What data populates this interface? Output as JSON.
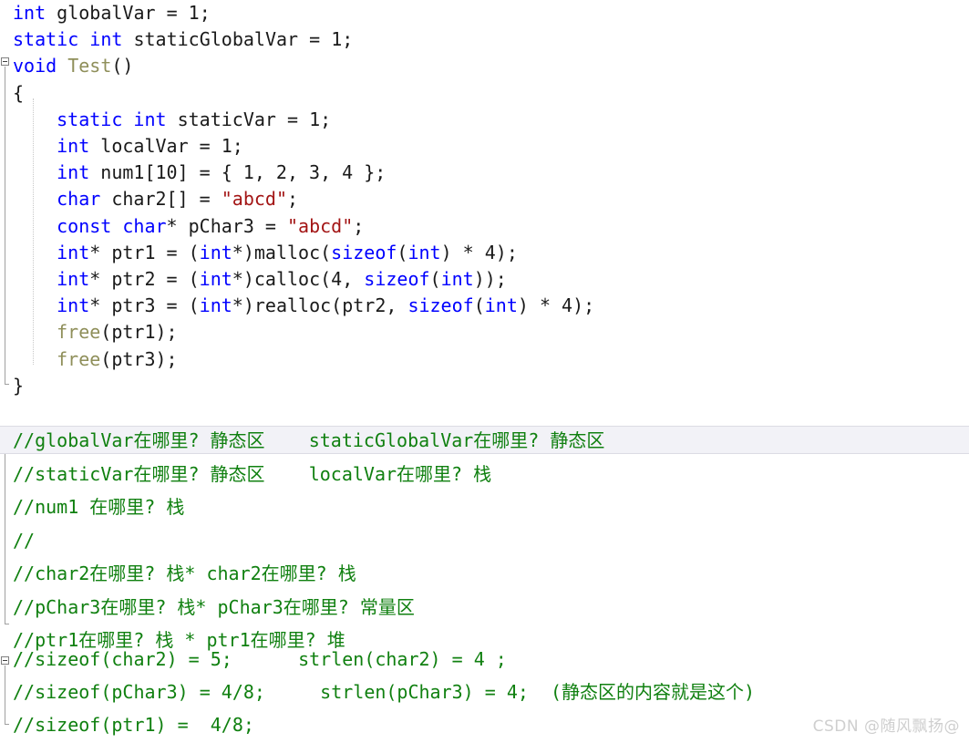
{
  "editor": {
    "name": "visual-studio-code-editor",
    "background": "#ffffff",
    "colors": {
      "keyword": "#0000ff",
      "function": "#8f8f5a",
      "string": "#a31515",
      "comment": "#108010",
      "plain": "#1a1a1a",
      "current_line_highlight": "#f2f2f7",
      "fold_marker": "#808080",
      "watermark": "#cfcfcf"
    }
  },
  "code": {
    "lines": [
      {
        "id": "line-1",
        "indent": 0,
        "tokens": [
          {
            "t": "int",
            "c": "kw"
          },
          {
            "t": " globalVar = 1;",
            "c": "plain"
          }
        ]
      },
      {
        "id": "line-2",
        "indent": 0,
        "tokens": [
          {
            "t": "static",
            "c": "kw"
          },
          {
            "t": " ",
            "c": "plain"
          },
          {
            "t": "int",
            "c": "kw"
          },
          {
            "t": " staticGlobalVar = 1;",
            "c": "plain"
          }
        ]
      },
      {
        "id": "line-3",
        "indent": 0,
        "tokens": [
          {
            "t": "void",
            "c": "kw"
          },
          {
            "t": " ",
            "c": "plain"
          },
          {
            "t": "Test",
            "c": "fn"
          },
          {
            "t": "()",
            "c": "plain"
          }
        ]
      },
      {
        "id": "line-4",
        "indent": 0,
        "tokens": [
          {
            "t": "{",
            "c": "plain"
          }
        ]
      },
      {
        "id": "line-5",
        "indent": 1,
        "tokens": [
          {
            "t": "static",
            "c": "kw"
          },
          {
            "t": " ",
            "c": "plain"
          },
          {
            "t": "int",
            "c": "kw"
          },
          {
            "t": " staticVar = 1;",
            "c": "plain"
          }
        ]
      },
      {
        "id": "line-6",
        "indent": 1,
        "tokens": [
          {
            "t": "int",
            "c": "kw"
          },
          {
            "t": " localVar = 1;",
            "c": "plain"
          }
        ]
      },
      {
        "id": "line-7",
        "indent": 1,
        "tokens": [
          {
            "t": "int",
            "c": "kw"
          },
          {
            "t": " num1[10] = { 1, 2, 3, 4 };",
            "c": "plain"
          }
        ]
      },
      {
        "id": "line-8",
        "indent": 1,
        "tokens": [
          {
            "t": "char",
            "c": "kw"
          },
          {
            "t": " char2[] = ",
            "c": "plain"
          },
          {
            "t": "\"abcd\"",
            "c": "str"
          },
          {
            "t": ";",
            "c": "plain"
          }
        ]
      },
      {
        "id": "line-9",
        "indent": 1,
        "tokens": [
          {
            "t": "const",
            "c": "kw"
          },
          {
            "t": " ",
            "c": "plain"
          },
          {
            "t": "char",
            "c": "kw"
          },
          {
            "t": "* pChar3 = ",
            "c": "plain"
          },
          {
            "t": "\"abcd\"",
            "c": "str"
          },
          {
            "t": ";",
            "c": "plain"
          }
        ]
      },
      {
        "id": "line-10",
        "indent": 1,
        "tokens": [
          {
            "t": "int",
            "c": "kw"
          },
          {
            "t": "* ptr1 = (",
            "c": "plain"
          },
          {
            "t": "int",
            "c": "kw"
          },
          {
            "t": "*)malloc(",
            "c": "plain"
          },
          {
            "t": "sizeof",
            "c": "kw"
          },
          {
            "t": "(",
            "c": "plain"
          },
          {
            "t": "int",
            "c": "kw"
          },
          {
            "t": ") * 4);",
            "c": "plain"
          }
        ]
      },
      {
        "id": "line-11",
        "indent": 1,
        "tokens": [
          {
            "t": "int",
            "c": "kw"
          },
          {
            "t": "* ptr2 = (",
            "c": "plain"
          },
          {
            "t": "int",
            "c": "kw"
          },
          {
            "t": "*)calloc(4, ",
            "c": "plain"
          },
          {
            "t": "sizeof",
            "c": "kw"
          },
          {
            "t": "(",
            "c": "plain"
          },
          {
            "t": "int",
            "c": "kw"
          },
          {
            "t": "));",
            "c": "plain"
          }
        ]
      },
      {
        "id": "line-12",
        "indent": 1,
        "tokens": [
          {
            "t": "int",
            "c": "kw"
          },
          {
            "t": "* ptr3 = (",
            "c": "plain"
          },
          {
            "t": "int",
            "c": "kw"
          },
          {
            "t": "*)realloc(ptr2, ",
            "c": "plain"
          },
          {
            "t": "sizeof",
            "c": "kw"
          },
          {
            "t": "(",
            "c": "plain"
          },
          {
            "t": "int",
            "c": "kw"
          },
          {
            "t": ") * 4);",
            "c": "plain"
          }
        ]
      },
      {
        "id": "line-13",
        "indent": 1,
        "tokens": [
          {
            "t": "free",
            "c": "fn"
          },
          {
            "t": "(ptr1);",
            "c": "plain"
          }
        ]
      },
      {
        "id": "line-14",
        "indent": 1,
        "tokens": [
          {
            "t": "free",
            "c": "fn"
          },
          {
            "t": "(ptr3);",
            "c": "plain"
          }
        ]
      },
      {
        "id": "line-15",
        "indent": 0,
        "tokens": [
          {
            "t": "}",
            "c": "plain"
          }
        ]
      }
    ]
  },
  "comment_block_1": {
    "highlighted_line_index": 0,
    "lines": [
      "//globalVar在哪里? 静态区    staticGlobalVar在哪里? 静态区",
      "//staticVar在哪里? 静态区    localVar在哪里? 栈",
      "//num1 在哪里? 栈",
      "//",
      "//char2在哪里? 栈* char2在哪里? 栈",
      "//pChar3在哪里? 栈* pChar3在哪里? 常量区",
      "//ptr1在哪里? 栈 * ptr1在哪里? 堆"
    ]
  },
  "comment_block_2": {
    "lines": [
      "//sizeof(char2) = 5;      strlen(char2) = 4 ;",
      "//sizeof(pChar3) = 4/8;     strlen(pChar3) = 4;  (静态区的内容就是这个)",
      "//sizeof(ptr1) =  4/8;"
    ]
  },
  "watermark": {
    "text": "CSDN @随风飘扬@"
  }
}
